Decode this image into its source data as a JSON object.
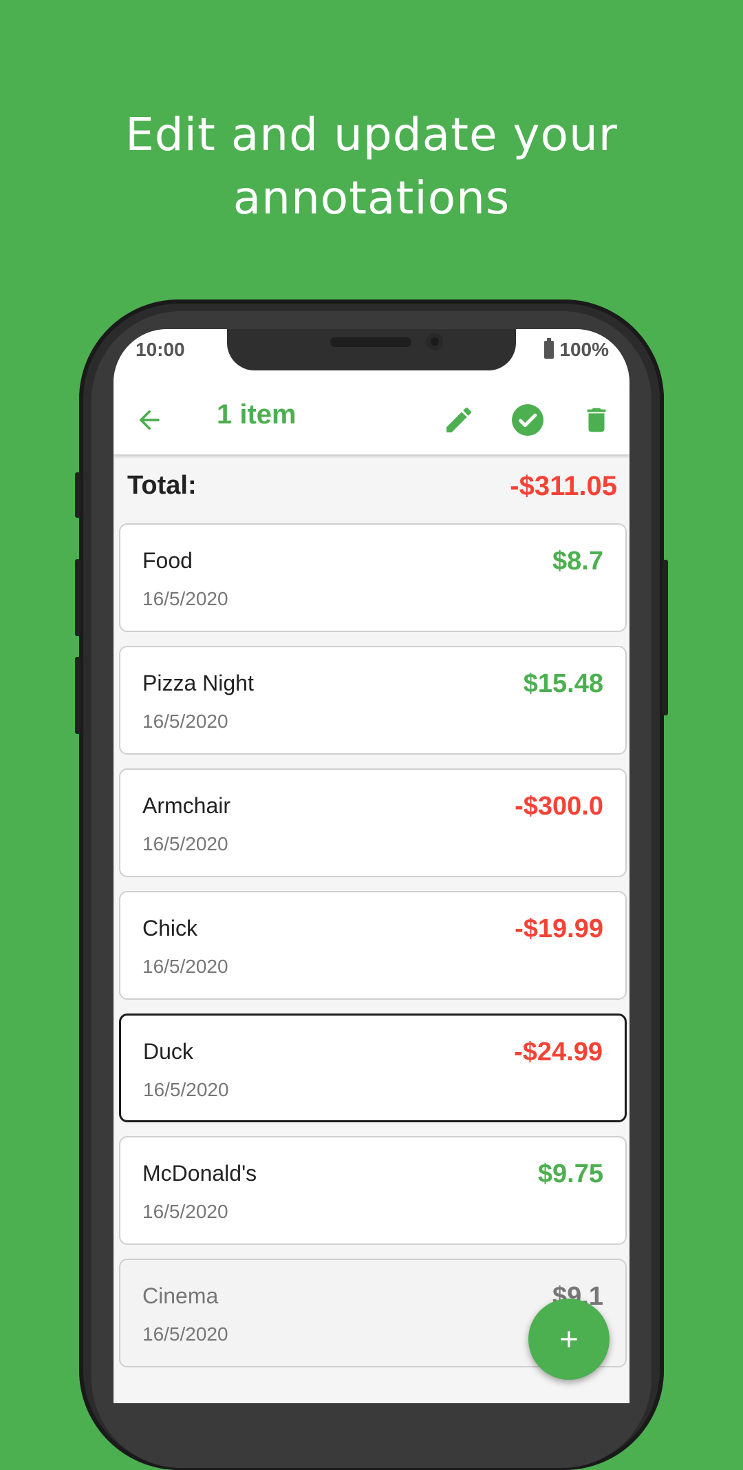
{
  "headline": {
    "line1": "Edit and update your",
    "line2": "annotations"
  },
  "status": {
    "time": "10:00",
    "battery": "100%"
  },
  "appbar": {
    "title": "1 item"
  },
  "colors": {
    "positive": "#4caf50",
    "negative": "#f44336"
  },
  "total": {
    "label": "Total:",
    "value": "-$311.05"
  },
  "items": [
    {
      "name": "Food",
      "date": "16/5/2020",
      "amount": "$8.7",
      "sign": "positive"
    },
    {
      "name": "Pizza Night",
      "date": "16/5/2020",
      "amount": "$15.48",
      "sign": "positive"
    },
    {
      "name": "Armchair",
      "date": "16/5/2020",
      "amount": "-$300.0",
      "sign": "negative"
    },
    {
      "name": "Chick",
      "date": "16/5/2020",
      "amount": "-$19.99",
      "sign": "negative"
    },
    {
      "name": "Duck",
      "date": "16/5/2020",
      "amount": "-$24.99",
      "sign": "negative",
      "selected": true
    },
    {
      "name": "McDonald's",
      "date": "16/5/2020",
      "amount": "$9.75",
      "sign": "positive"
    },
    {
      "name": "Cinema",
      "date": "16/5/2020",
      "amount": "$9.1",
      "sign": "neutral"
    }
  ],
  "icons": {
    "back": "arrow-left-icon",
    "edit": "pencil-icon",
    "confirm": "check-circle-icon",
    "delete": "trash-icon",
    "add": "plus-icon"
  }
}
